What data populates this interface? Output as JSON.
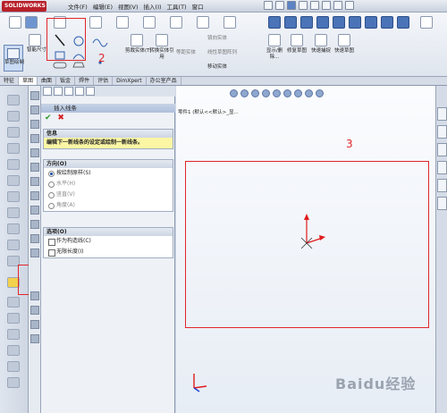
{
  "app": {
    "logo_text": "SOLIDWORKS",
    "menus": [
      "文件(F)",
      "编辑(E)",
      "视图(V)",
      "插入(I)",
      "工具(T)",
      "窗口"
    ]
  },
  "ribbon": {
    "sketch_button": "草图绘制",
    "smart_dim_label": "智能尺寸",
    "trim_label": "剪裁实体(T)",
    "convert_label": "转换实体引用",
    "offset_label": "等距实体",
    "mirror_label": "镜向实体",
    "linear_pattern_label": "线性草图阵列",
    "move_label": "移动实体",
    "display_delete_label": "显示/删除...",
    "repair_label": "修复草图",
    "quick_snap_label": "快速捕捉",
    "rapid_sketch_label": "快速草图"
  },
  "tabs": [
    "特征",
    "草图",
    "曲面",
    "钣金",
    "焊件",
    "评估",
    "DimXpert",
    "办公室产品"
  ],
  "pm": {
    "title": "插入线条",
    "ok_glyph": "✔",
    "cancel_glyph": "✖",
    "info_group": "信息",
    "info_text": "编辑下一新线条的设定或绘制一新线条。",
    "orientation_group": "方向(O)",
    "orientation_options": [
      "按绘制原样(S)",
      "水平(H)",
      "竖直(V)",
      "角度(A)"
    ],
    "options_group": "选项(O)",
    "options": [
      "作为构造线(C)",
      "无限长度(I)"
    ]
  },
  "canvas": {
    "tree_text": "零件1 (默认<<默认>_显..."
  },
  "annotations": [
    "1",
    "2",
    "3"
  ],
  "watermark": "Baidu经验",
  "colors": {
    "accent_red": "#e0262a",
    "triad_red": "#e01b1b",
    "triad_blue": "#1b3fd1"
  }
}
